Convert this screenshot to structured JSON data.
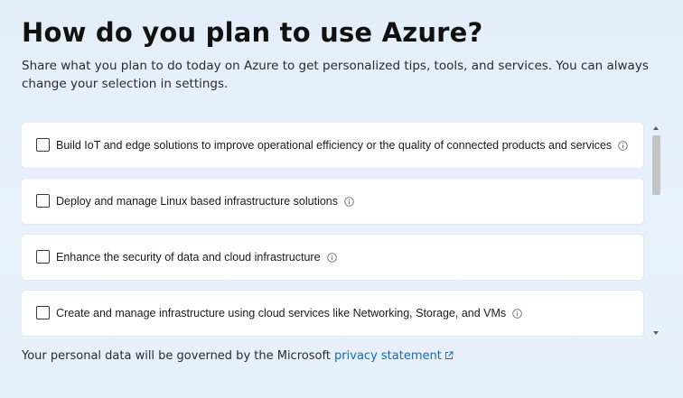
{
  "header": {
    "title": "How do you plan to use Azure?",
    "subtitle": "Share what you plan to do today on Azure to get personalized tips, tools, and services. You can always change your selection in settings."
  },
  "options": [
    {
      "label": "Build IoT and edge solutions to improve operational efficiency or the quality of connected products and services",
      "checked": false,
      "icon": "info-icon"
    },
    {
      "label": "Deploy and manage Linux based infrastructure solutions",
      "checked": false,
      "icon": "info-icon"
    },
    {
      "label": "Enhance the security of data and cloud infrastructure",
      "checked": false,
      "icon": "info-icon"
    },
    {
      "label": "Create and manage infrastructure using cloud services like Networking, Storage, and VMs",
      "checked": false,
      "icon": "info-icon"
    }
  ],
  "footer": {
    "text": "Your personal data will be governed by the Microsoft",
    "link": "privacy statement",
    "link_icon": "external-link-icon"
  },
  "colors": {
    "link": "#0f6cbd",
    "background": "#e6f0fa",
    "card": "#ffffff"
  }
}
